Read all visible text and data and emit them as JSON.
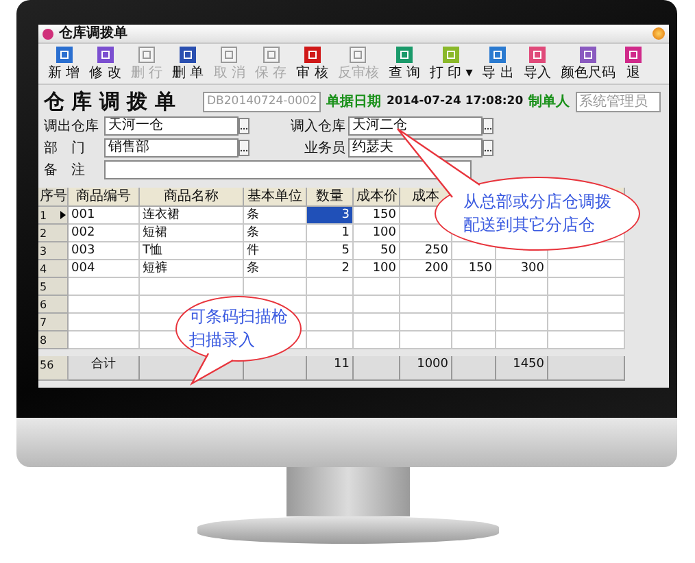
{
  "window": {
    "title": "仓库调拨单"
  },
  "toolbar": [
    {
      "label": "新 增",
      "disabled": false,
      "color": "#2a6fd0"
    },
    {
      "label": "修 改",
      "disabled": false,
      "color": "#7b4fd0"
    },
    {
      "label": "删 行",
      "disabled": true,
      "color": "#9a9a9a"
    },
    {
      "label": "删 单",
      "disabled": false,
      "color": "#2a4fb0"
    },
    {
      "label": "取 消",
      "disabled": true,
      "color": "#9a9a9a"
    },
    {
      "label": "保 存",
      "disabled": true,
      "color": "#9a9a9a"
    },
    {
      "label": "审 核",
      "disabled": false,
      "color": "#d01818"
    },
    {
      "label": "反审核",
      "disabled": true,
      "color": "#9a9a9a"
    },
    {
      "label": "查 询",
      "disabled": false,
      "color": "#1a9a6a"
    },
    {
      "label": "打 印",
      "disabled": false,
      "color": "#8ab82a",
      "dropdown": "▾"
    },
    {
      "label": "导 出",
      "disabled": false,
      "color": "#2a7ad0"
    },
    {
      "label": "导入",
      "disabled": false,
      "color": "#e04a7a"
    },
    {
      "label": "颜色尺码",
      "disabled": false,
      "color": "#8a5ac0"
    },
    {
      "label": "退",
      "disabled": false,
      "color": "#d02a8a"
    }
  ],
  "form": {
    "title": "仓 库 调 拨 单",
    "doc_number": "DB20140724-0002",
    "date_label": "单据日期",
    "date": "2014-07-24 17:08:20",
    "maker_label": "制单人",
    "maker": "系统管理员",
    "rows": [
      [
        {
          "label": "调出仓库",
          "value": "天河一仓",
          "lookup": true
        },
        {
          "label": "调入仓库",
          "value": "天河二仓",
          "lookup": true
        }
      ],
      [
        {
          "label": "部　门",
          "value": "销售部",
          "lookup": true
        },
        {
          "label": "业务员",
          "value": "约瑟夫",
          "lookup": true
        }
      ],
      [
        {
          "label": "备　注",
          "lookup": false
        }
      ]
    ]
  },
  "table": {
    "index_header": "序号",
    "columns": [
      {
        "label": "商品编号",
        "focused": false
      },
      {
        "label": "商品名称",
        "focused": false
      },
      {
        "label": "基本单位",
        "focused": false
      },
      {
        "label": "数量",
        "focused": true
      },
      {
        "label": "成本价",
        "focused": false
      },
      {
        "label": "成本",
        "focused": false
      }
    ],
    "rows": [
      {
        "number": "1",
        "selected": true,
        "cells": [
          "001",
          "连衣裙",
          "条",
          "3",
          "150",
          null,
          null,
          null,
          null
        ]
      },
      {
        "number": "2",
        "selected": false,
        "cells": [
          "002",
          "短裙",
          "条",
          "1",
          "100",
          null,
          null,
          null,
          null
        ]
      },
      {
        "number": "3",
        "selected": false,
        "cells": [
          "003",
          "T恤",
          "件",
          "5",
          "50",
          "250",
          null,
          null,
          null
        ]
      },
      {
        "number": "4",
        "selected": false,
        "cells": [
          "004",
          "短裤",
          "条",
          "2",
          "100",
          "200",
          "150",
          "300",
          null
        ]
      },
      {
        "number": "5",
        "selected": false,
        "cells": []
      },
      {
        "number": "6",
        "selected": false,
        "cells": []
      },
      {
        "number": "7",
        "selected": false,
        "cells": []
      },
      {
        "number": "8",
        "selected": false,
        "cells": []
      }
    ],
    "totals": {
      "number": "56",
      "cells": [
        "合计",
        null,
        null,
        "11",
        null,
        "1000",
        null,
        "1450",
        null
      ]
    }
  },
  "callouts": [
    {
      "lines": [
        "从总部或分店仓调拨",
        "配送到其它分店仓"
      ]
    },
    {
      "lines": [
        "可条码扫描枪",
        "扫描录入"
      ]
    }
  ]
}
